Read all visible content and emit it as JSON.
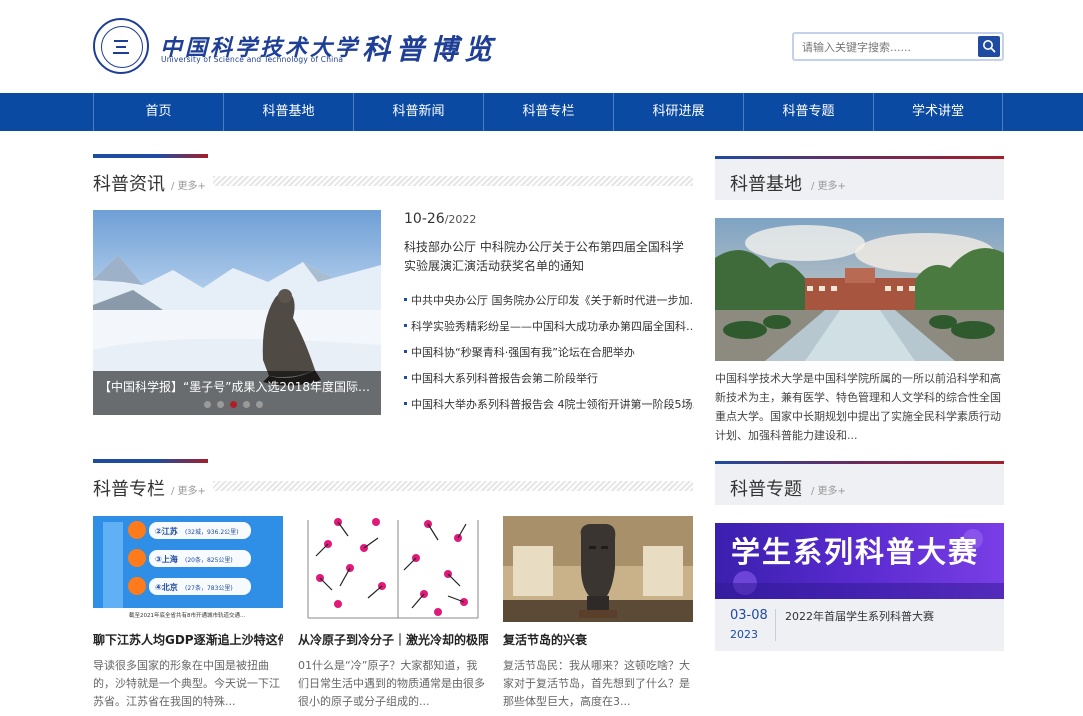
{
  "header": {
    "logo_cn": "中国科学技术大学",
    "logo_en": "University of Science and Technology of China",
    "subtitle": "科普博览",
    "search_placeholder": "请输入关键字搜索......"
  },
  "nav": {
    "items": [
      "首页",
      "科普基地",
      "科普新闻",
      "科普专栏",
      "科研进展",
      "科普专题",
      "学术讲堂"
    ]
  },
  "news": {
    "title": "科普资讯",
    "more": "/ 更多+",
    "slider_caption": "【中国科学报】“墨子号”成果入选2018年度国际…",
    "slide_count": 5,
    "active_slide": 3,
    "featured_date": "10-26",
    "featured_year": "/2022",
    "featured_title": "科技部办公厅 中科院办公厅关于公布第四届全国科学实验展演汇演活动获奖名单的通知",
    "list": [
      "中共中央办公厅 国务院办公厅印发《关于新时代进一步加…",
      "科学实验秀精彩纷呈——中国科大成功承办第四届全国科…",
      "中国科协“秒聚青科·强国有我”论坛在合肥举办",
      "中国科大系列科普报告会第二阶段举行",
      "中国科大举办系列科普报告会 4院士领衔开讲第一阶段5场…"
    ]
  },
  "base": {
    "title": "科普基地",
    "more": "/ 更多+",
    "text": "中国科学技术大学是中国科学院所属的一所以前沿科学和高新技术为主，兼有医学、特色管理和人文学科的综合性全国重点大学。国家中长期规划中提出了实施全民科学素质行动计划、加强科普能力建设和..."
  },
  "column": {
    "title": "科普专栏",
    "more": "/ 更多+",
    "cards": [
      {
        "title": "聊下江苏人均GDP逐渐追上沙特这件…",
        "desc": "导读很多国家的形象在中国是被扭曲的，沙特就是一个典型。今天说一下江苏省。江苏省在我国的特殊...",
        "labels": [
          "②江苏",
          "(32城，936.2公里)",
          "③上海",
          "(20条，825公里)",
          "④北京",
          "(27条，783公里)"
        ],
        "footer_text": "截至2021年底全省共有8市开通城市轨道交通..."
      },
      {
        "title": "从冷原子到冷分子｜激光冷却的极限…",
        "desc": "01什么是“冷”原子？大家都知道，我们日常生活中遇到的物质通常是由很多很小的原子或分子组成的..."
      },
      {
        "title": "复活节岛的兴衰",
        "desc": "复活节岛民：我从哪来？这顿吃啥？大家对于复活节岛，首先想到了什么？是那些体型巨大，高度在3..."
      }
    ]
  },
  "topic": {
    "title": "科普专题",
    "more": "/ 更多+",
    "banner_text": "学生系列科普大赛",
    "date": "03-08",
    "year": "2023",
    "item_title": "2022年首届学生系列科普大赛"
  },
  "colors": {
    "nav_bg": "#0b4aa2",
    "brand_blue": "#1e3f95",
    "accent_red": "#a1202a",
    "side_bg": "#eef0f3"
  }
}
